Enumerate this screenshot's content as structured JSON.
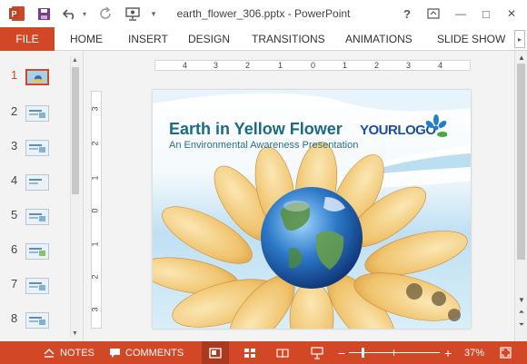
{
  "window": {
    "title": "earth_flower_306.pptx - PowerPoint",
    "help": "?",
    "min": "—",
    "max": "□",
    "close": "✕",
    "dropdown": "▾"
  },
  "ribbon": {
    "file": "FILE",
    "tabs": [
      "HOME",
      "INSERT",
      "DESIGN",
      "TRANSITIONS",
      "ANIMATIONS",
      "SLIDE SHOW"
    ],
    "expand": "▸"
  },
  "thumbnails": {
    "numbers": [
      "1",
      "2",
      "3",
      "4",
      "5",
      "6",
      "7",
      "8"
    ],
    "selected": 1
  },
  "ruler": {
    "horizontal": [
      "4",
      "3",
      "2",
      "1",
      "0",
      "1",
      "2",
      "3",
      "4"
    ],
    "vertical": [
      "3",
      "2",
      "1",
      "0",
      "1",
      "2",
      "3"
    ]
  },
  "slide": {
    "title": "Earth in Yellow Flower",
    "subtitle": "An Environmental Awareness Presentation",
    "logo_your": "YOUR",
    "logo_logo": "LOGO"
  },
  "status": {
    "notes": "NOTES",
    "comments": "COMMENTS",
    "zoom_minus": "−",
    "zoom_plus": "+",
    "zoom_level": "37%",
    "zoom_value": 0.37
  },
  "colors": {
    "accent": "#d24726",
    "title_text": "#1b6a86"
  }
}
